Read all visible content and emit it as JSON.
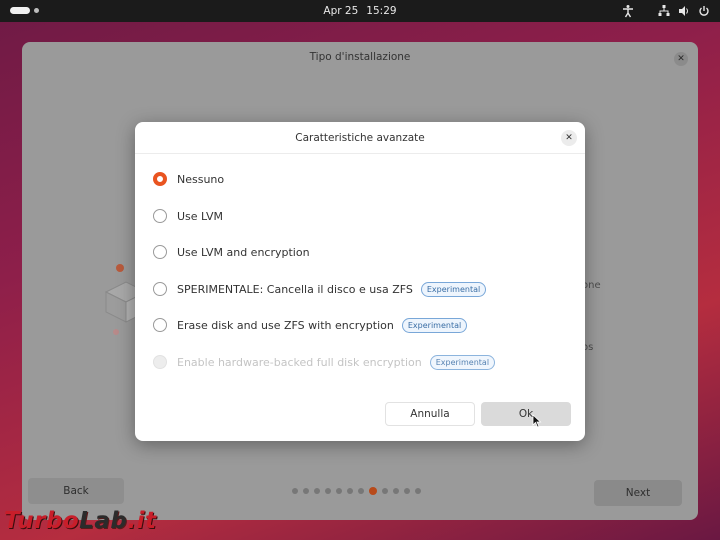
{
  "topbar": {
    "date": "Apr 25",
    "time": "15:29",
    "icons": [
      "accessibility-icon",
      "network-icon",
      "volume-icon",
      "power-icon"
    ]
  },
  "window": {
    "title": "Tipo d'installazione",
    "back_label": "Back",
    "next_label": "Next",
    "side_text_1": "one",
    "side_text_2": "os",
    "pager": {
      "total": 12,
      "current": 8
    }
  },
  "dialog": {
    "title": "Caratteristiche avanzate",
    "options": [
      {
        "label": "Nessuno",
        "selected": true,
        "disabled": false,
        "badge": ""
      },
      {
        "label": "Use LVM",
        "selected": false,
        "disabled": false,
        "badge": ""
      },
      {
        "label": "Use LVM and encryption",
        "selected": false,
        "disabled": false,
        "badge": ""
      },
      {
        "label": "SPERIMENTALE: Cancella il disco e usa ZFS",
        "selected": false,
        "disabled": false,
        "badge": "Experimental"
      },
      {
        "label": "Erase disk and use ZFS with encryption",
        "selected": false,
        "disabled": false,
        "badge": "Experimental"
      },
      {
        "label": "Enable hardware-backed full disk encryption",
        "selected": false,
        "disabled": true,
        "badge": "Experimental"
      }
    ],
    "cancel_label": "Annulla",
    "ok_label": "Ok"
  },
  "watermark": {
    "part1": "Turbo",
    "part2": "Lab",
    "part3": ".it"
  },
  "colors": {
    "accent": "#e95420",
    "badge_border": "#79a7d8"
  }
}
